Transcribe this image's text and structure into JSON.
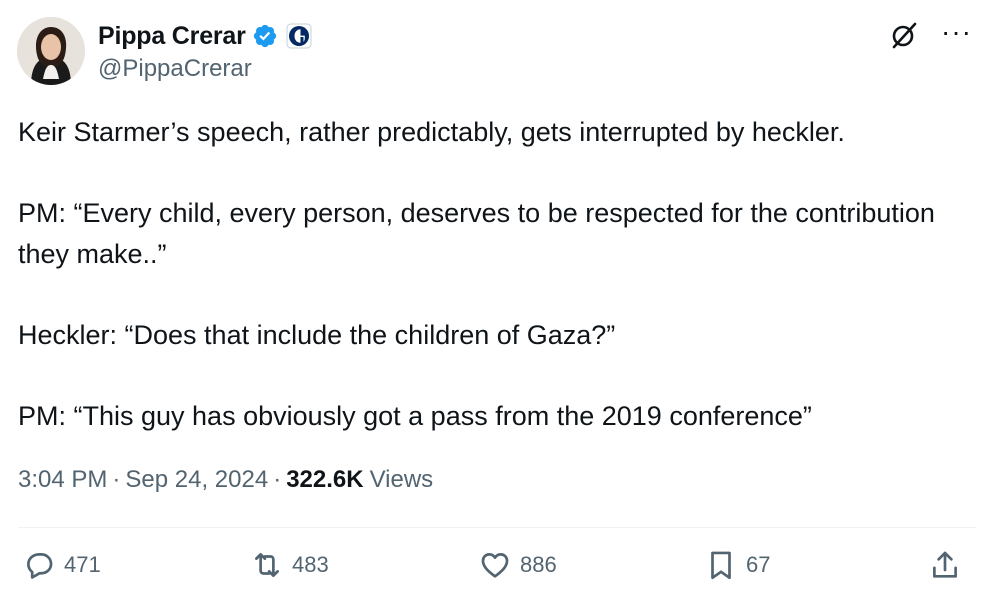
{
  "author": {
    "display_name": "Pippa Crerar",
    "handle": "@PippaCrerar"
  },
  "icons": {
    "verified": "verified-badge-icon",
    "affiliation": "guardian-affiliate-icon",
    "grok": "grok-icon",
    "more": "more-icon"
  },
  "tweet": {
    "paragraphs": [
      "Keir Starmer’s speech, rather predictably, gets interrupted by heckler.",
      "PM: “Every child, every person, deserves to be respected for the contribution they make..”",
      "Heckler: “Does that include the children of Gaza?”",
      "PM: “This guy has obviously got a pass from the 2019 conference”"
    ]
  },
  "meta": {
    "time": "3:04 PM",
    "separator": "·",
    "date": "Sep 24, 2024",
    "views_count": "322.6K",
    "views_label": "Views"
  },
  "actions": {
    "reply_count": "471",
    "repost_count": "483",
    "like_count": "886",
    "bookmark_count": "67"
  },
  "colors": {
    "text": "#0f1419",
    "secondary": "#536471",
    "verified_blue": "#1d9bf0",
    "divider": "#eff3f4"
  }
}
